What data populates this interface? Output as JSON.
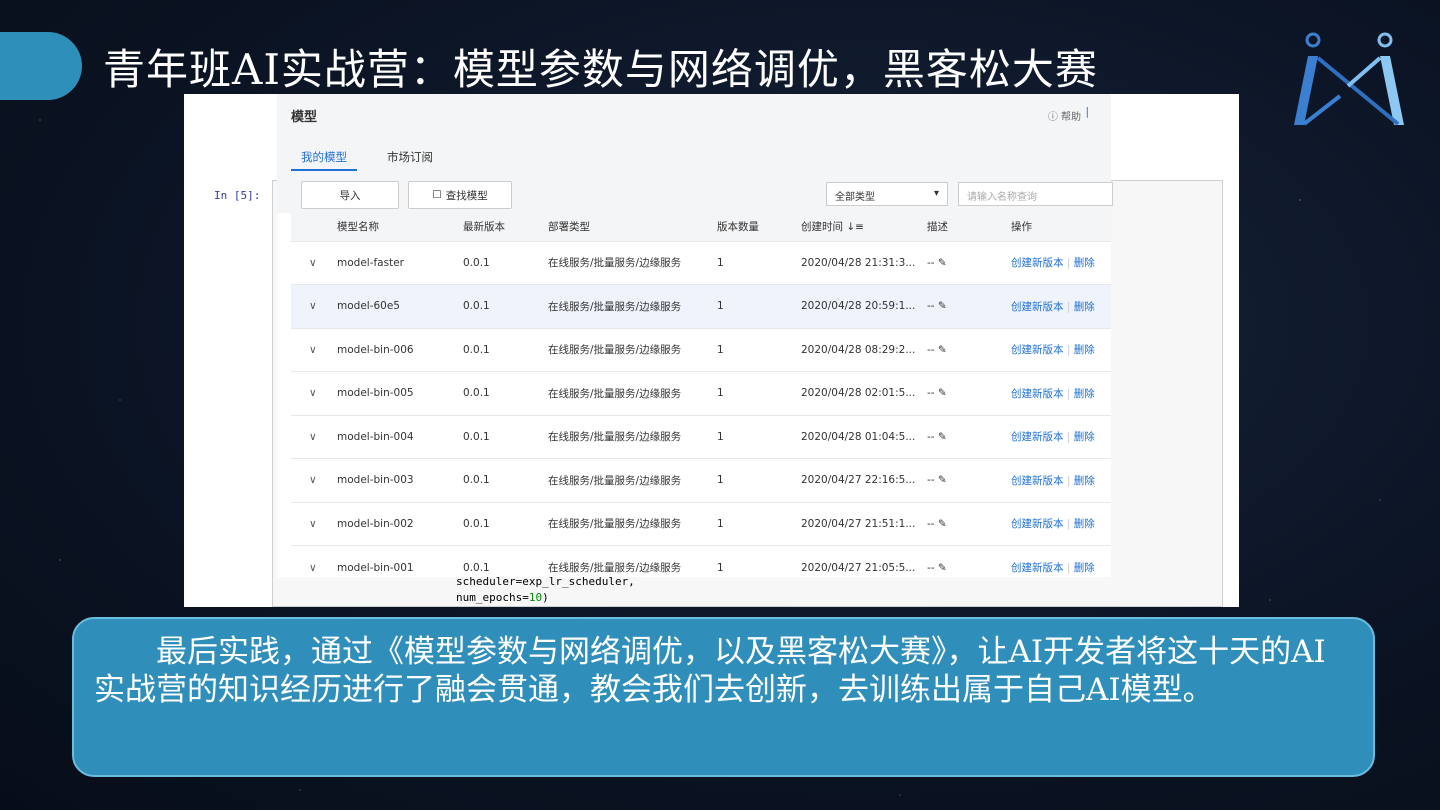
{
  "slide": {
    "title": "青年班AI实战营：模型参数与网络调优，黑客松大赛",
    "summary": "最后实践，通过《模型参数与网络调优，以及黑客松大赛》，让AI开发者将这十天的AI实战营的知识经历进行了融会贯通，教会我们去创新，去训练出属于自己AI模型。"
  },
  "notebook": {
    "prompt": "In  [5]:",
    "code_line1": "scheduler=exp_lr_scheduler,",
    "code_line2_prefix": "num_epochs=",
    "code_line2_num": "10",
    "code_line2_suffix": ")"
  },
  "console": {
    "title": "模型",
    "help": "帮助",
    "sep": "|",
    "tabs": [
      "我的模型",
      "市场订阅"
    ],
    "import_label": "导入",
    "find_label": "查找模型",
    "type_select": "全部类型",
    "search_placeholder": "请输入名称查询",
    "columns": [
      "模型名称",
      "最新版本",
      "部署类型",
      "版本数量",
      "创建时间",
      "描述",
      "操作"
    ],
    "sort_icon": "↓≡",
    "rows": [
      {
        "name": "model-faster",
        "version": "0.0.1",
        "deploy": "在线服务/批量服务/边缘服务",
        "count": "1",
        "created": "2020/04/28 21:31:3...",
        "desc": "--"
      },
      {
        "name": "model-60e5",
        "version": "0.0.1",
        "deploy": "在线服务/批量服务/边缘服务",
        "count": "1",
        "created": "2020/04/28 20:59:1...",
        "desc": "--"
      },
      {
        "name": "model-bin-006",
        "version": "0.0.1",
        "deploy": "在线服务/批量服务/边缘服务",
        "count": "1",
        "created": "2020/04/28 08:29:2...",
        "desc": "--"
      },
      {
        "name": "model-bin-005",
        "version": "0.0.1",
        "deploy": "在线服务/批量服务/边缘服务",
        "count": "1",
        "created": "2020/04/28 02:01:5...",
        "desc": "--"
      },
      {
        "name": "model-bin-004",
        "version": "0.0.1",
        "deploy": "在线服务/批量服务/边缘服务",
        "count": "1",
        "created": "2020/04/28 01:04:5...",
        "desc": "--"
      },
      {
        "name": "model-bin-003",
        "version": "0.0.1",
        "deploy": "在线服务/批量服务/边缘服务",
        "count": "1",
        "created": "2020/04/27 22:16:5...",
        "desc": "--"
      },
      {
        "name": "model-bin-002",
        "version": "0.0.1",
        "deploy": "在线服务/批量服务/边缘服务",
        "count": "1",
        "created": "2020/04/27 21:51:1...",
        "desc": "--"
      },
      {
        "name": "model-bin-001",
        "version": "0.0.1",
        "deploy": "在线服务/批量服务/边缘服务",
        "count": "1",
        "created": "2020/04/27 21:05:5...",
        "desc": "--"
      }
    ],
    "action_new": "创建新版本",
    "action_delete": "删除"
  }
}
